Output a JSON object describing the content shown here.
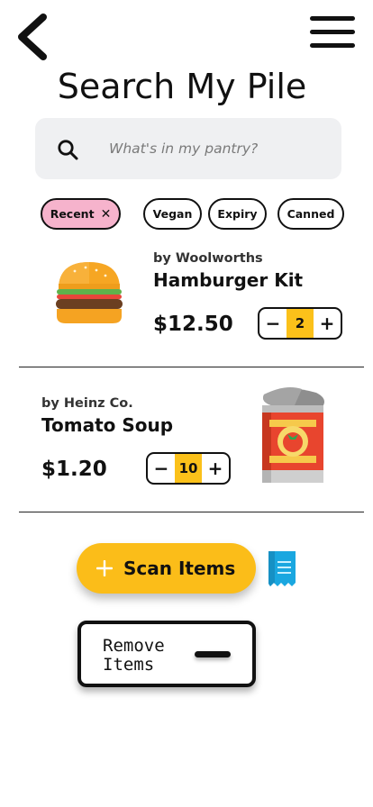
{
  "header": {
    "title": "Search My Pile",
    "back_icon": "chevron-left-icon",
    "menu_icon": "hamburger-menu-icon"
  },
  "search": {
    "placeholder": "What's in my pantry?",
    "value": ""
  },
  "filters": [
    {
      "label": "Recent",
      "active": true,
      "removable": true
    },
    {
      "label": "Vegan",
      "active": false
    },
    {
      "label": "Expiry",
      "active": false
    },
    {
      "label": "Canned",
      "active": false
    }
  ],
  "products": [
    {
      "brand": "by Woolworths",
      "name": "Hamburger Kit",
      "price": "$12.50",
      "quantity": "2",
      "icon": "hamburger-icon"
    },
    {
      "brand": "by Heinz Co.",
      "name": "Tomato Soup",
      "price": "$1.20",
      "quantity": "10",
      "icon": "tomato-soup-can-icon"
    }
  ],
  "actions": {
    "scan_label": "Scan Items",
    "remove_label": "Remove Items"
  },
  "colors": {
    "accent_yellow": "#fbbd19",
    "chip_active_pink": "#f6b3cc",
    "search_bg": "#eff0f2",
    "receipt_blue": "#1aa7e0"
  }
}
